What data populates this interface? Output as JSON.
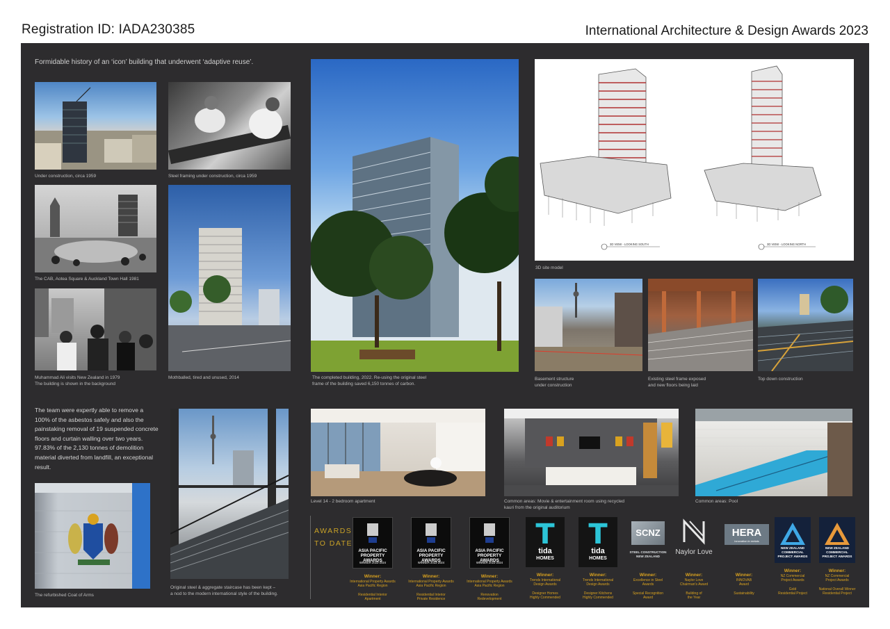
{
  "header": {
    "registration": "Registration ID:  IADA230385",
    "event": "International Architecture & Design Awards 2023"
  },
  "intro": "Formidable history of an ‘icon’ building that underwent ‘adaptive reuse’.",
  "captions": {
    "c1": "Under construction, circa 1959",
    "c2": "Steel framing under construction, circa 1959",
    "c3": "The CAB, Aotea Square & Auckland Town Hall 1981",
    "c4a": "Muhammad Ali visits New Zealand in 1979",
    "c4b": "The building is shown in the background",
    "c5": "Mothballed, tired and unused, 2014",
    "c6a": "The completed building, 2022.  Re-using the original steel",
    "c6b": "frame of the building saved 6,150 tonnes of carbon.",
    "c7": "3D site model",
    "c8a": "Basement structure",
    "c8b": "under construction",
    "c9a": "Existing steel frame exposed",
    "c9b": "and new floors being laid",
    "c10": "Top down construction",
    "c11": "The refurbished Coat of Arms",
    "c12a": "Original steel & aggregate staircase has been kept –",
    "c12b": "a nod to the modern international style of the building.",
    "c13": "Level 14 - 2 bedroom apartment",
    "c14a": "Common areas: Movie & entertainment room using recycled",
    "c14b": "kauri from the original auditorium",
    "c15": "Common areas: Pool"
  },
  "paragraph": "The team were expertly able to remove a 100% of the asbestos safely and also the painstaking removal of 19 suspended concrete floors and curtain walling over two years. 97.83% of the 2,130 tonnes of demolition material diverted from landfill, an exceptional result.",
  "model_labels": {
    "south": "3D VIEW - LOOKING SOUTH",
    "north": "3D VIEW - LOOKING NORTH"
  },
  "awards_label": [
    "AWARDS",
    "TO DATE:"
  ],
  "awards": [
    {
      "logo": "ASIA PACIFIC PROPERTY AWARDS",
      "logo_sub": "WINNER 2023-2024",
      "win": "Winner:",
      "a1": "International Property Awards",
      "a2": "Asia Pacific Region",
      "c1": "Residential Interior",
      "c2": "Apartment"
    },
    {
      "logo": "ASIA PACIFIC PROPERTY AWARDS",
      "logo_sub": "WINNER 2023-2024",
      "win": "Winner:",
      "a1": "International Property Awards",
      "a2": "Asia Pacific Region",
      "c1": "Residential Interior",
      "c2": "Private Residence"
    },
    {
      "logo": "ASIA PACIFIC PROPERTY AWARDS",
      "logo_sub": "WINNER 2023-2024",
      "win": "Winner:",
      "a1": "International Property Awards",
      "a2": "Asia Pacific Region",
      "c1": "Renovation",
      "c2": "Redevelopment"
    },
    {
      "logo": "tida",
      "logo_sub": "HOMES",
      "win": "Winner:",
      "a1": "Trends International",
      "a2": "Design Awards",
      "c1": "Designer Homes",
      "c2": "Highly Commended"
    },
    {
      "logo": "tida",
      "logo_sub": "HOMES",
      "win": "Winner:",
      "a1": "Trends International",
      "a2": "Design Awards",
      "c1": "Designer Kitchens",
      "c2": "Highly Commended"
    },
    {
      "logo": "SCNZ",
      "logo_sub": "STEEL CONSTRUCTION NEW ZEALAND",
      "win": "Winner:",
      "a1": "Excellence in Steel",
      "a2": "Awards",
      "c1": "Special Recognition",
      "c2": "Award"
    },
    {
      "logo": "Naylor Love",
      "logo_sub": "",
      "win": "Winner:",
      "a1": "Naylor Love",
      "a2": "Chairman's Award",
      "c1": "Building of",
      "c2": "the Year"
    },
    {
      "logo": "HERA",
      "logo_sub": "innovation in metals",
      "win": "Winner:",
      "a1": "INNOVAB",
      "a2": "Award",
      "c1": "Sustainability",
      "c2": ""
    },
    {
      "logo": "NEW ZEALAND COMMERCIAL PROJECT AWARDS",
      "logo_sub": "",
      "win": "Winner:",
      "a1": "NZ Commercial",
      "a2": "Project Awards",
      "c1": "Gold",
      "c2": "Residential Project"
    },
    {
      "logo": "NEW ZEALAND COMMERCIAL PROJECT AWARDS",
      "logo_sub": "",
      "win": "Winner:",
      "a1": "NZ Commercial",
      "a2": "Project Awards",
      "c1": "National Overall Winner",
      "c2": "Residential Project"
    }
  ]
}
